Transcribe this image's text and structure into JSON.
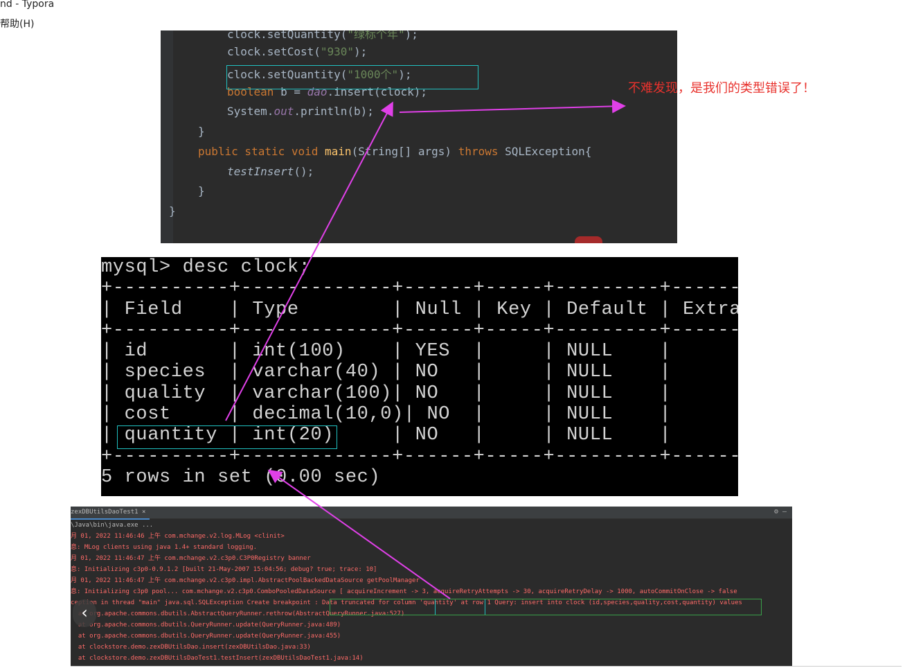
{
  "window": {
    "title": "nd - Typora",
    "menu_help": "帮助(H)"
  },
  "code": {
    "lines": [
      "clock.setQuantity(\"绿标个年\");",
      "clock.setCost(\"930\");",
      "clock.setQuantity(\"1000个\");",
      "boolean b = dao.insert(clock);",
      "System.out.println(b);",
      "}",
      "public static void main(String[] args) throws SQLException{",
      "testInsert();",
      "}",
      "}"
    ]
  },
  "mysql": {
    "text": "mysql> desc clock;\n+----------+-------------+------+-----+---------+-------+\n| Field    | Type        | Null | Key | Default | Extra |\n+----------+-------------+------+-----+---------+-------+\n| id       | int(100)    | YES  |     | NULL    |       |\n| species  | varchar(40) | NO   |     | NULL    |       |\n| quality  | varchar(100)| NO   |     | NULL    |       |\n| cost     | decimal(10,0)| NO  |     | NULL    |       |\n| quantity | int(20)     | NO   |     | NULL    |       |\n+----------+-------------+------+-----+---------+-------+\n5 rows in set (0.00 sec)",
    "columns": [
      "Field",
      "Type",
      "Null",
      "Key",
      "Default",
      "Extra"
    ],
    "rows": [
      [
        "id",
        "int(100)",
        "YES",
        "",
        "NULL",
        ""
      ],
      [
        "species",
        "varchar(40)",
        "NO",
        "",
        "NULL",
        ""
      ],
      [
        "quality",
        "varchar(100)",
        "NO",
        "",
        "NULL",
        ""
      ],
      [
        "cost",
        "decimal(10,0)",
        "NO",
        "",
        "NULL",
        ""
      ],
      [
        "quantity",
        "int(20)",
        "NO",
        "",
        "NULL",
        ""
      ]
    ],
    "footer": "5 rows in set (0.00 sec)"
  },
  "console": {
    "tab_label": "zexDBUtilsDaoTest1",
    "lines": [
      "\\Java\\bin\\java.exe ...",
      "月 01, 2022 11:46:46 上午 com.mchange.v2.log.MLog <clinit>",
      "息: MLog clients using java 1.4+ standard logging.",
      "月 01, 2022 11:46:47 上午 com.mchange.v2.c3p0.C3P0Registry banner",
      "息: Initializing c3p0-0.9.1.2 [built 21-May-2007 15:04:56; debug? true; trace: 10]",
      "月 01, 2022 11:46:47 上午 com.mchange.v2.c3p0.impl.AbstractPoolBackedDataSource getPoolManager",
      "息: Initializing c3p0 pool... com.mchange.v2.c3p0.ComboPooledDataSource [ acquireIncrement -> 3, acquireRetryAttempts -> 30, acquireRetryDelay -> 1000, autoCommitOnClose -> false",
      "ception in thread \"main\" java.sql.SQLException Create breakpoint : Data truncated for column 'quantity' at row 1 Query: insert into clock (id,species,quality,cost,quantity) values",
      "  at org.apache.commons.dbutils.AbstractQueryRunner.rethrow(AbstractQueryRunner.java:527)",
      "  at org.apache.commons.dbutils.QueryRunner.update(QueryRunner.java:489)",
      "  at org.apache.commons.dbutils.QueryRunner.update(QueryRunner.java:455)",
      "  at clockstore.demo.zexDBUtilsDao.insert(zexDBUtilsDao.java:33)",
      "  at clockstore.demo.zexDBUtilsDaoTest1.testInsert(zexDBUtilsDaoTest1.java:14)"
    ]
  },
  "annotation": "不难发现，是我们的类型错误了！",
  "colors": {
    "arrow": "#e040e8",
    "highlight_box": "#21c2c2",
    "annotation_text": "#e8322d"
  }
}
